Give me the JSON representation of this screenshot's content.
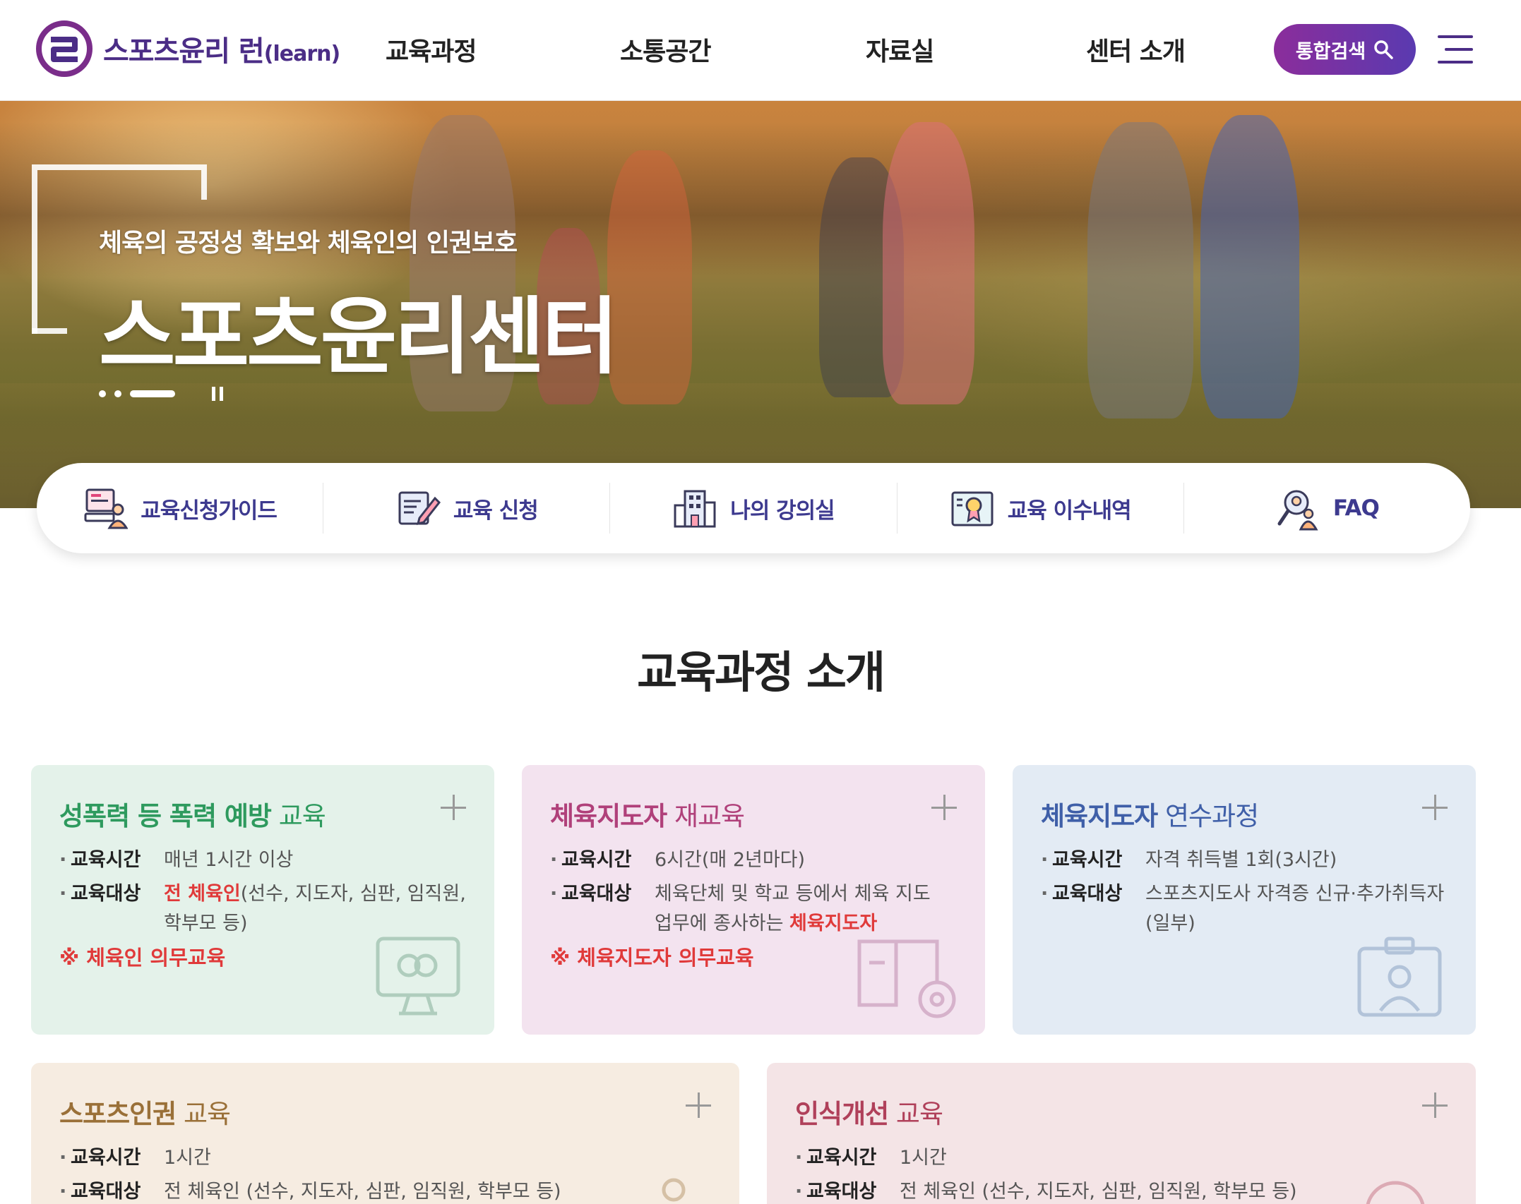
{
  "header": {
    "logo_text": "스포츠윤리 런",
    "logo_suffix": "(learn)",
    "nav": [
      "교육과정",
      "소통공간",
      "자료실",
      "센터 소개"
    ],
    "search_label": "통합검색",
    "brand_color": "#4b2d86"
  },
  "hero": {
    "subtitle": "체육의 공정성 확보와 체육인의 인권보호",
    "title": "스포츠윤리센터"
  },
  "quick_menu": [
    {
      "label": "교육신청가이드",
      "icon": "monitor-person-icon"
    },
    {
      "label": "교육 신청",
      "icon": "edit-document-icon"
    },
    {
      "label": "나의 강의실",
      "icon": "building-icon"
    },
    {
      "label": "교육 이수내역",
      "icon": "certificate-icon"
    },
    {
      "label": "FAQ",
      "icon": "search-person-icon"
    }
  ],
  "section_title": "교육과정 소개",
  "cards": [
    {
      "title_strong": "성폭력 등 폭력 예방",
      "title_rest": " 교육",
      "title_color": "#2e9a5e",
      "bg": "#e4f2ea",
      "time_key": "교육시간",
      "time_val": "매년 1시간 이상",
      "target_key": "교육대상",
      "target_hl": "전 체육인",
      "target_val": "(선수, 지도자, 심판, 임직원, 학부모 등)",
      "note": "※ 체육인 의무교육"
    },
    {
      "title_strong": "체육지도자",
      "title_rest": " 재교육",
      "title_color": "#b0407a",
      "bg": "#f3e3ef",
      "time_key": "교육시간",
      "time_val": "6시간(매 2년마다)",
      "target_key": "교육대상",
      "target_val": "체육단체 및 학교 등에서 체육 지도 업무에 종사하는 ",
      "target_hl": "체육지도자",
      "note": "※ 체육지도자 의무교육"
    },
    {
      "title_strong": "체육지도자",
      "title_rest": " 연수과정",
      "title_color": "#3f5fa8",
      "bg": "#e3ebf4",
      "time_key": "교육시간",
      "time_val": "자격 취득별 1회(3시간)",
      "target_key": "교육대상",
      "target_val": "스포츠지도사 자격증 신규·추가취득자 (일부)"
    },
    {
      "title_strong": "스포츠인권",
      "title_rest": " 교육",
      "title_color": "#9a7038",
      "bg": "#f6ece1",
      "time_key": "교육시간",
      "time_val": "1시간",
      "target_key": "교육대상",
      "target_val": "전 체육인 (선수, 지도자, 심판, 임직원, 학부모 등)"
    },
    {
      "title_strong": "인식개선",
      "title_rest": " 교육",
      "title_color": "#b0405a",
      "bg": "#f4e4e6",
      "time_key": "교육시간",
      "time_val": "1시간",
      "target_key": "교육대상",
      "target_val": "전 체육인 (선수, 지도자, 심판, 임직원, 학부모 등)"
    }
  ]
}
